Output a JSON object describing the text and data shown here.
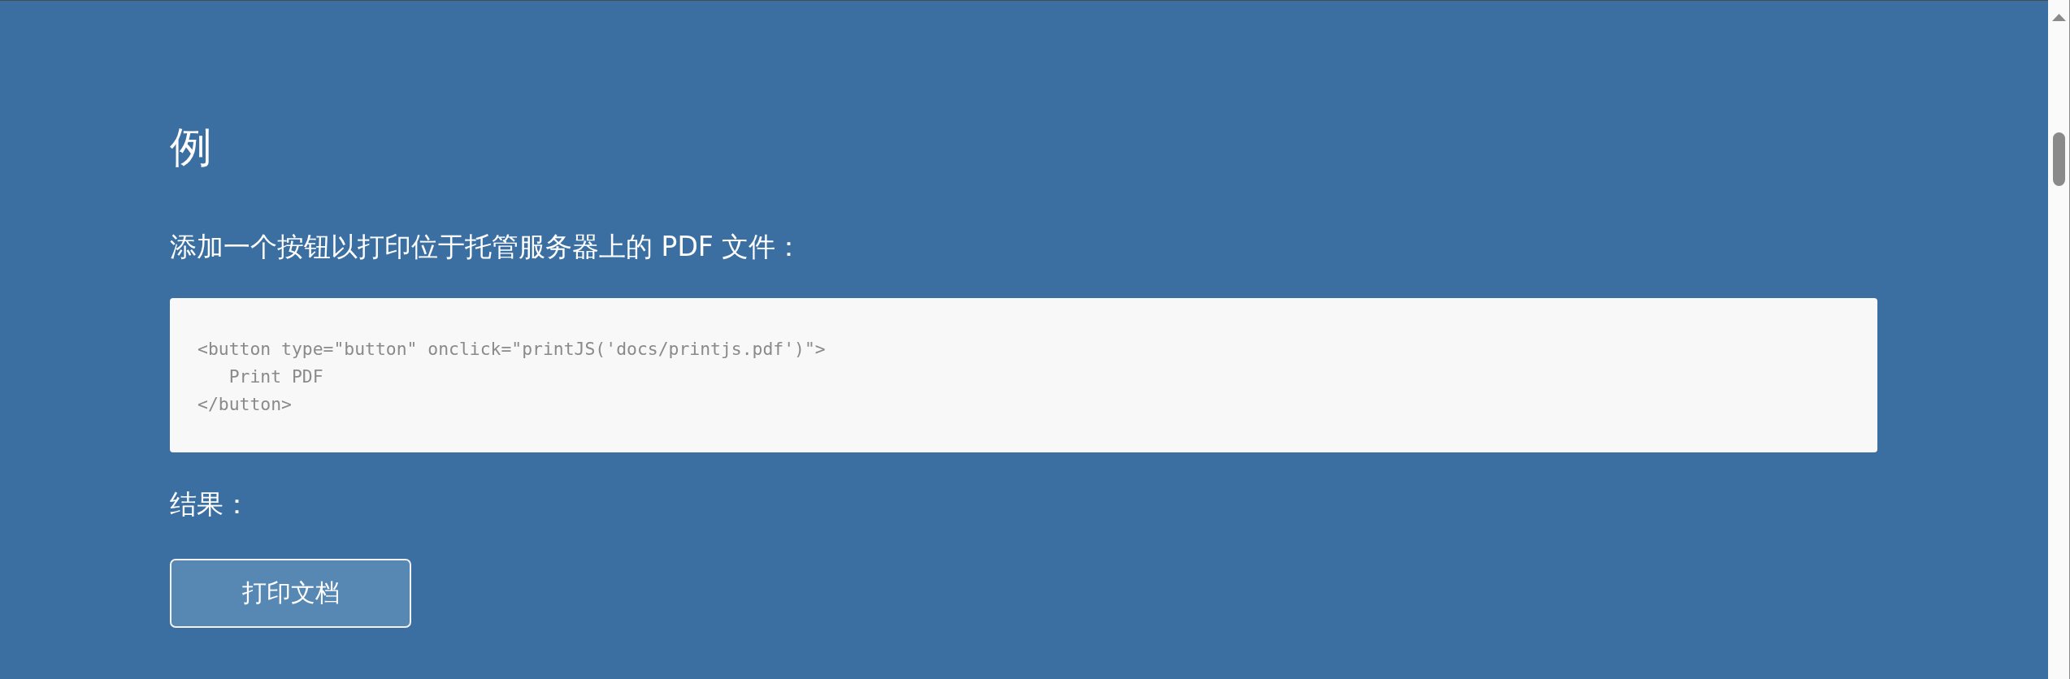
{
  "heading": "例",
  "intro": "添加一个按钮以打印位于托管服务器上的 PDF 文件：",
  "code_block": {
    "lines": [
      "<button type=\"button\" onclick=\"printJS('docs/printjs.pdf')\">",
      "   Print PDF",
      "</button>"
    ]
  },
  "result_label": "结果：",
  "demo_button": {
    "label": "打印文档"
  }
}
